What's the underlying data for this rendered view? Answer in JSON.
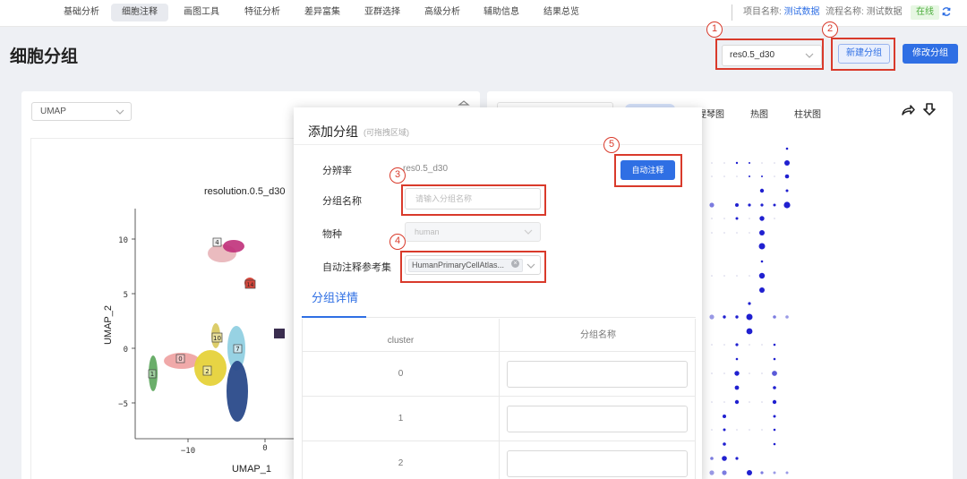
{
  "topnav": {
    "items": [
      "基础分析",
      "细胞注释",
      "画图工具",
      "特征分析",
      "差异富集",
      "亚群选择",
      "高级分析",
      "辅助信息",
      "结果总览"
    ],
    "active_index": 1,
    "project_label": "项目名称:",
    "project_value": "测试数据",
    "flow_label": "流程名称:",
    "flow_value": "测试数据",
    "status": "在线"
  },
  "page_title": "细胞分组",
  "toolbar": {
    "resolution_value": "res0.5_d30",
    "new_group_label": "新建分组",
    "edit_group_label": "修改分组"
  },
  "callouts": [
    "1",
    "2",
    "3",
    "4",
    "5"
  ],
  "left_panel": {
    "reduction_value": "UMAP",
    "plot_title": "resolution.0.5_d30",
    "xlabel": "UMAP_1",
    "ylabel": "UMAP_2",
    "y_ticks": [
      "10",
      "5",
      "0",
      "−5"
    ],
    "x_ticks": [
      "−10",
      "0"
    ],
    "cluster_labels": [
      "4",
      "14",
      "10",
      "0",
      "7",
      "2",
      "1",
      "3"
    ]
  },
  "right_panel": {
    "tabs": [
      "提琴图",
      "热图",
      "柱状图"
    ]
  },
  "modal": {
    "title": "添加分组",
    "hint": "(可拖拽区域)",
    "resolution_label": "分辨率",
    "resolution_value": "res0.5_d30",
    "group_name_label": "分组名称",
    "group_name_placeholder": "请输入分组名称",
    "species_label": "物种",
    "species_value": "human",
    "ref_label": "自动注释参考集",
    "ref_tag": "HumanPrimaryCellAtlas...",
    "auto_button": "自动注释",
    "detail_tab": "分组详情",
    "table": {
      "col_cluster": "cluster",
      "col_name": "分组名称",
      "rows": [
        "0",
        "1",
        "2"
      ]
    }
  },
  "colors": {
    "accent": "#2f6fe4",
    "callout": "#d93a2b",
    "online": "#4cae3c"
  }
}
